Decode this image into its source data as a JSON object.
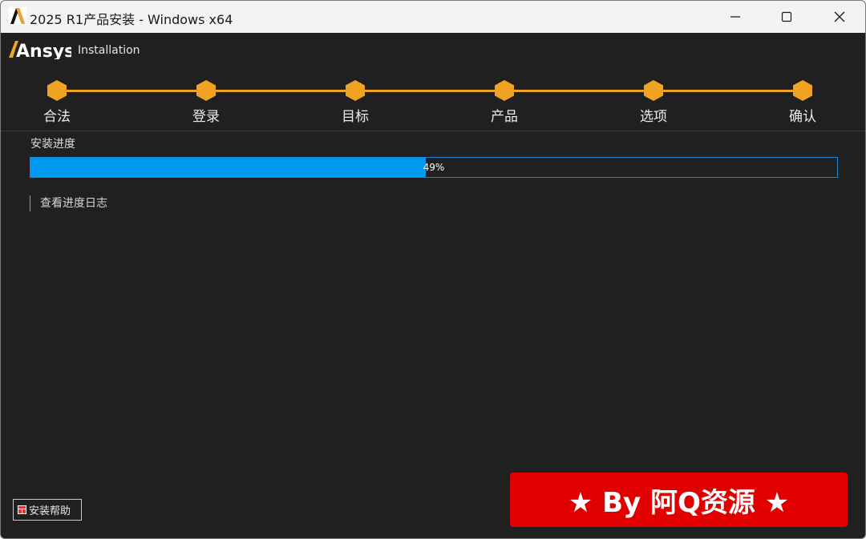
{
  "window": {
    "title": "2025 R1产品安装 - Windows x64",
    "controls": {
      "minimize": "minimize-icon",
      "maximize": "maximize-icon",
      "close": "close-icon"
    }
  },
  "brand": {
    "logo_text": "Ansys",
    "subtitle": "Installation",
    "accent": "#f0a322"
  },
  "steps": [
    {
      "label": "合法"
    },
    {
      "label": "登录"
    },
    {
      "label": "目标"
    },
    {
      "label": "产品"
    },
    {
      "label": "选项"
    },
    {
      "label": "确认"
    }
  ],
  "progress": {
    "title": "安装进度",
    "value": 49,
    "label": "49%",
    "fill_color": "#0098f0"
  },
  "log_link": "查看进度日志",
  "help_button": "安装帮助",
  "watermark": "★ By 阿Q资源 ★"
}
